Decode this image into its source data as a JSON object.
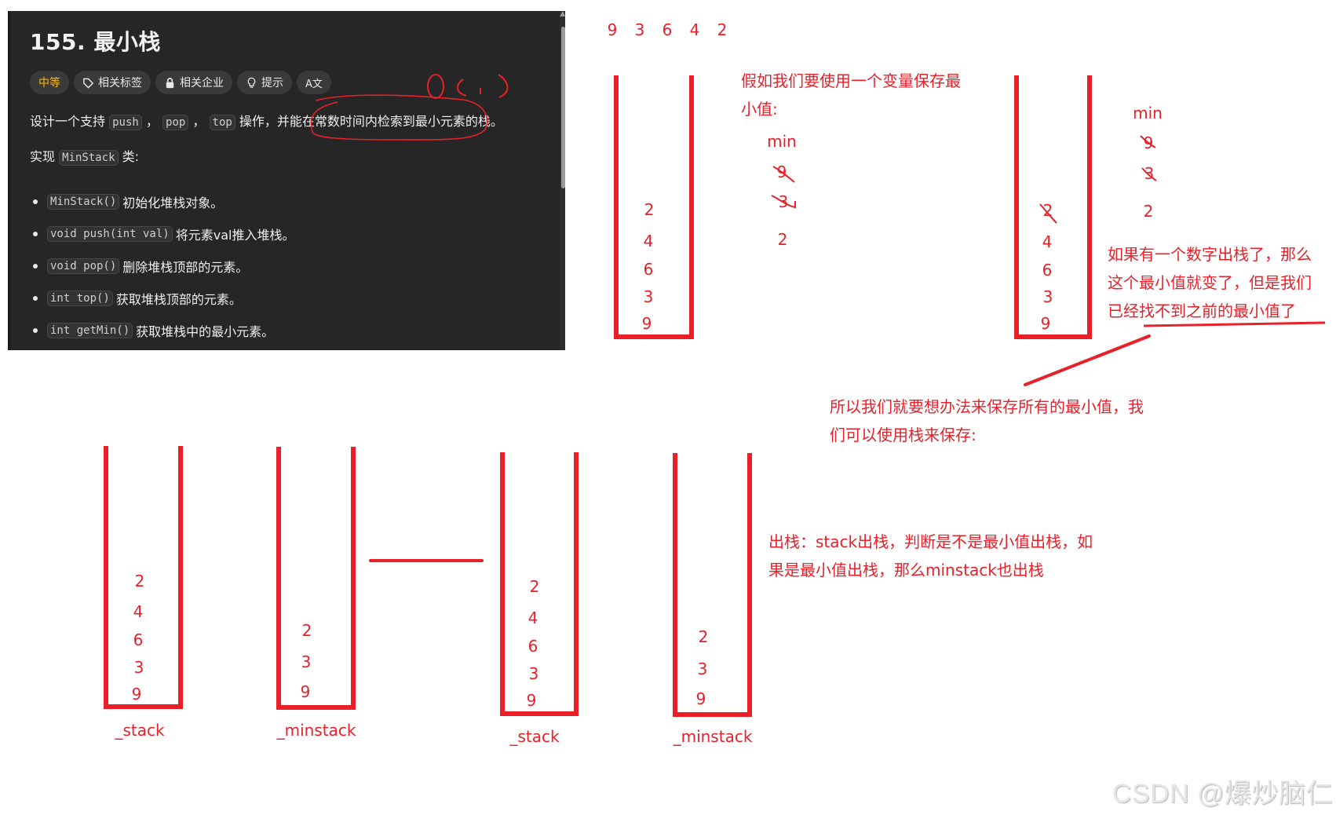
{
  "problem": {
    "title": "155. 最小栈",
    "chips": [
      {
        "label": "中等",
        "icon": null
      },
      {
        "label": "相关标签",
        "icon": "tag-icon"
      },
      {
        "label": "相关企业",
        "icon": "lock-icon"
      },
      {
        "label": "提示",
        "icon": "lightbulb-icon"
      },
      {
        "label": "A文",
        "icon": "translate-icon"
      }
    ],
    "description": {
      "prefix": "设计一个支持",
      "code1": "push",
      "sep1": "，",
      "code2": "pop",
      "sep2": "，",
      "code3": "top",
      "suffix": "操作，并能在常数时间内检索到最小元素的栈。"
    },
    "implement": {
      "prefix": "实现",
      "code": "MinStack",
      "suffix": "类:"
    },
    "methods": [
      {
        "code": "MinStack()",
        "text": "初始化堆栈对象。"
      },
      {
        "code": "void push(int val)",
        "text": "将元素val推入堆栈。"
      },
      {
        "code": "void pop()",
        "text": "删除堆栈顶部的元素。"
      },
      {
        "code": "int top()",
        "text": "获取堆栈顶部的元素。"
      },
      {
        "code": "int getMin()",
        "text": "获取堆栈中的最小元素。"
      }
    ],
    "handwritten_note": "O(1)"
  },
  "diagram": {
    "push_sequence": [
      "9",
      "3",
      "6",
      "4",
      "2"
    ],
    "stack_top_view_1": [
      "2",
      "4",
      "6",
      "3",
      "9"
    ],
    "stack_top_view_2": [
      "2",
      "4",
      "6",
      "3",
      "9"
    ],
    "note_variable": [
      "假如我们要使用一个变量保存最",
      "小值:"
    ],
    "min_column_1": {
      "label": "min",
      "values": [
        "9",
        "3",
        "2"
      ],
      "crossed": [
        true,
        true,
        false
      ]
    },
    "min_column_2": {
      "label": "min",
      "values": [
        "9",
        "3",
        "2"
      ],
      "crossed": [
        true,
        true,
        false
      ]
    },
    "stack2_crossed_top": true,
    "note_pop": [
      "如果有一个数字出栈了，那么",
      "这个最小值就变了，但是我们",
      "已经找不到之前的最小值了"
    ],
    "note_solution": [
      "所以我们就要想办法来保存所有的最小值，我",
      "们可以使用栈来保存:"
    ],
    "bottom_stacks": [
      {
        "label": "_stack",
        "values": [
          "2",
          "4",
          "6",
          "3",
          "9"
        ]
      },
      {
        "label": "_minstack",
        "values": [
          "2",
          "3",
          "9"
        ]
      },
      {
        "label": "_stack",
        "values": [
          "2",
          "4",
          "6",
          "3",
          "9"
        ]
      },
      {
        "label": "_minstack",
        "values": [
          "2",
          "3",
          "9"
        ]
      }
    ],
    "note_pop_rule": [
      "出栈：stack出栈，判断是不是最小值出栈，如",
      "果是最小值出栈，那么minstack也出栈"
    ],
    "accent_color": "#e8202a"
  },
  "watermark": "CSDN @爆炒脑仁"
}
